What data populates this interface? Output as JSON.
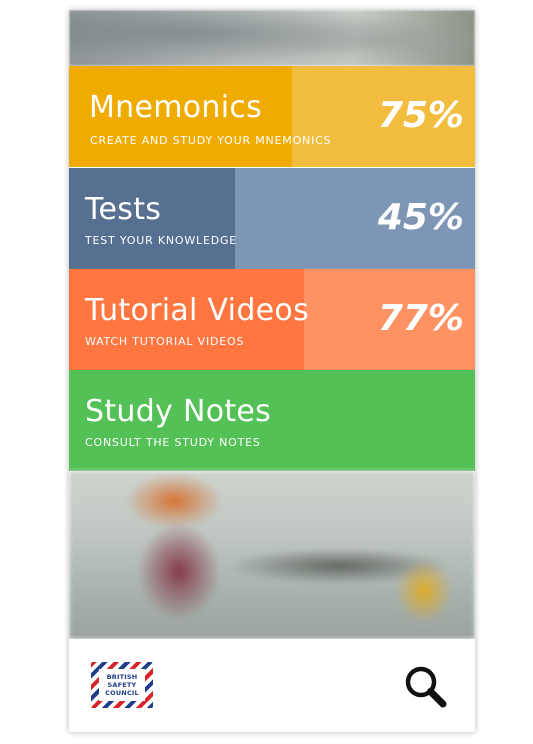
{
  "tiles": [
    {
      "title": "Mnemonics",
      "subtitle": "CREATE AND STUDY YOUR MNEMONICS",
      "percent": "75%",
      "progress": 0.55
    },
    {
      "title": "Tests",
      "subtitle": "TEST YOUR KNOWLEDGE",
      "percent": "45%",
      "progress": 0.41
    },
    {
      "title": "Tutorial Videos",
      "subtitle": "WATCH TUTORIAL VIDEOS",
      "percent": "77%",
      "progress": 0.58
    },
    {
      "title": "Study Notes",
      "subtitle": "CONSULT THE STUDY NOTES"
    }
  ],
  "logo": {
    "lines": [
      "BRITISH",
      "SAFETY",
      "COUNCIL"
    ]
  },
  "icons": {
    "search": "search-icon"
  },
  "colors": {
    "mnemonics": "#f0ab00",
    "tests": "#577092",
    "videos": "#ff7640",
    "notes": "#54c156"
  }
}
